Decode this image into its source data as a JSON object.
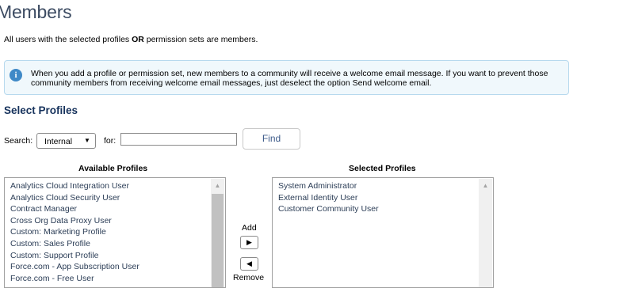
{
  "page": {
    "title": "Members",
    "intro_prefix": "All users with the selected profiles ",
    "intro_or": "OR",
    "intro_suffix": " permission sets are members."
  },
  "info": {
    "icon": "info-icon",
    "text": "When you add a profile or permission set, new members to a community will receive a welcome email message. If you want to prevent those community members from receiving welcome email messages, just deselect the option Send welcome email."
  },
  "profiles": {
    "section_title": "Select Profiles",
    "search_label": "Search:",
    "search_value": "Internal",
    "for_label": "for:",
    "for_value": "",
    "find_label": "Find",
    "available_header": "Available Profiles",
    "selected_header": "Selected Profiles",
    "available": [
      "Analytics Cloud Integration User",
      "Analytics Cloud Security User",
      "Contract Manager",
      "Cross Org Data Proxy User",
      "Custom: Marketing Profile",
      "Custom: Sales Profile",
      "Custom: Support Profile",
      "Force.com - App Subscription User",
      "Force.com - Free User"
    ],
    "selected": [
      "System Administrator",
      "External Identity User",
      "Customer Community User"
    ],
    "add_label": "Add",
    "remove_label": "Remove"
  },
  "colors": {
    "title": "#3c4b62",
    "info_bg": "#f0f8fc",
    "info_icon": "#3f89c7",
    "list_text": "#2c3e57"
  }
}
